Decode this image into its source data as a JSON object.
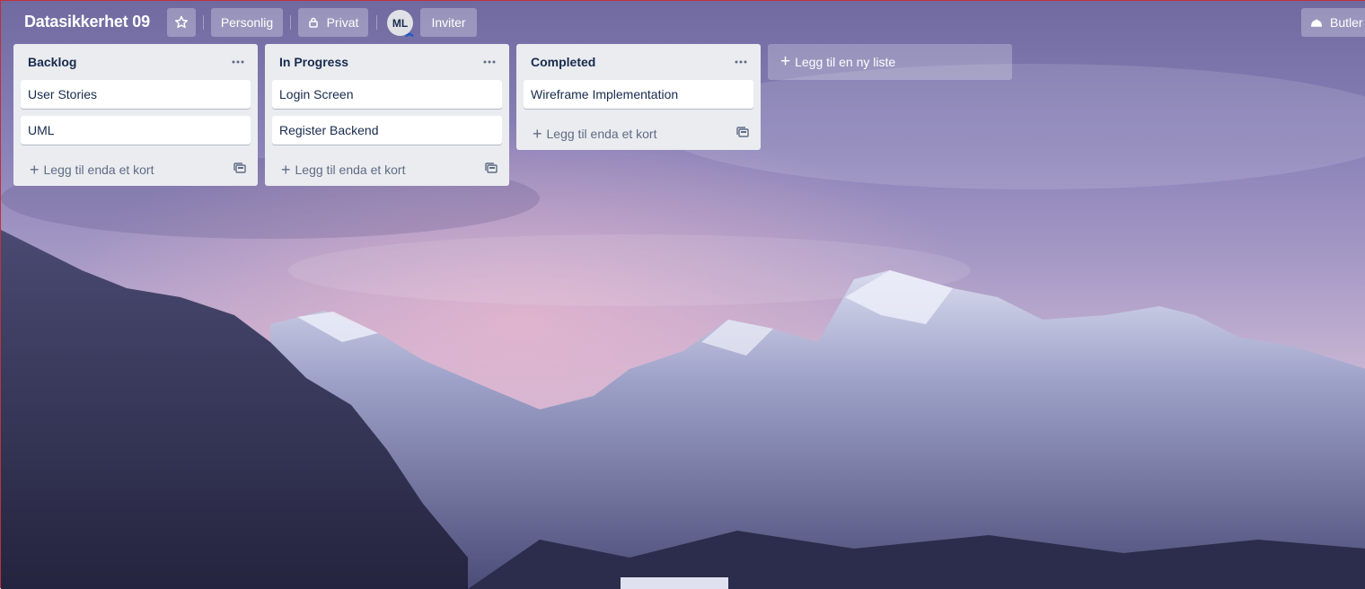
{
  "board": {
    "title": "Datasikkerhet 09",
    "visibility_team": "Personlig",
    "visibility_private": "Privat",
    "member_initials": "ML",
    "invite_label": "Inviter",
    "butler_label": "Butler"
  },
  "lists": [
    {
      "title": "Backlog",
      "cards": [
        "User Stories",
        "UML"
      ],
      "add_card_label": "Legg til enda et kort"
    },
    {
      "title": "In Progress",
      "cards": [
        "Login Screen",
        "Register Backend"
      ],
      "add_card_label": "Legg til enda et kort"
    },
    {
      "title": "Completed",
      "cards": [
        "Wireframe Implementation"
      ],
      "add_card_label": "Legg til enda et kort"
    }
  ],
  "add_list_label": "Legg til en ny liste",
  "icons": {
    "star": "star-icon",
    "lock": "lock-icon",
    "more": "ellipsis-icon",
    "plus": "plus-icon",
    "template": "card-template-icon",
    "butler": "butler-bell-icon"
  },
  "colors": {
    "list_bg": "#ebecf0",
    "card_bg": "#ffffff",
    "text": "#172b4d",
    "muted": "#5e6c84"
  }
}
